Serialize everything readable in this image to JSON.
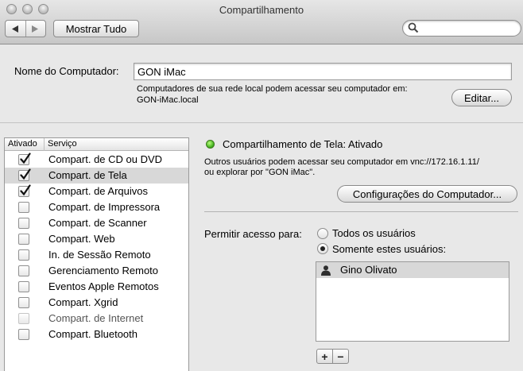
{
  "window": {
    "title": "Compartilhamento"
  },
  "toolbar": {
    "back_icon": "left-triangle",
    "forward_icon": "right-triangle",
    "show_all_label": "Mostrar Tudo",
    "search_placeholder": ""
  },
  "computer": {
    "name_label": "Nome do Computador:",
    "name_value": "GON iMac",
    "info_line1": "Computadores de sua rede local podem acessar seu computador em:",
    "info_line2": "GON-iMac.local",
    "edit_label": "Editar..."
  },
  "services": {
    "header_enabled": "Ativado",
    "header_service": "Serviço",
    "items": [
      {
        "label": "Compart. de CD ou DVD",
        "checked": true
      },
      {
        "label": "Compart. de Tela",
        "checked": true,
        "selected": true
      },
      {
        "label": "Compart. de Arquivos",
        "checked": true
      },
      {
        "label": "Compart. de Impressora",
        "checked": false
      },
      {
        "label": "Compart. de Scanner",
        "checked": false
      },
      {
        "label": "Compart. Web",
        "checked": false
      },
      {
        "label": "In. de Sessão Remoto",
        "checked": false
      },
      {
        "label": "Gerenciamento Remoto",
        "checked": false
      },
      {
        "label": "Eventos Apple Remotos",
        "checked": false
      },
      {
        "label": "Compart. Xgrid",
        "checked": false
      },
      {
        "label": "Compart. de Internet",
        "checked": false,
        "disabled": true
      },
      {
        "label": "Compart. Bluetooth",
        "checked": false
      }
    ]
  },
  "detail": {
    "status_color": "#3aa91a",
    "status_text": "Compartilhamento de Tela: Ativado",
    "info_line1": "Outros usuários podem acessar seu computador em vnc://172.16.1.11/",
    "info_line2": "ou explorar por \"GON iMac\".",
    "computer_settings_label": "Configurações do Computador...",
    "allow_label": "Permitir acesso para:",
    "radio_all_label": "Todos os usuários",
    "radio_only_label": "Somente estes usuários:",
    "selected_option": "only",
    "users": [
      {
        "name": "Gino Olivato",
        "icon": "user-silhouette-icon"
      }
    ],
    "add_label": "+",
    "remove_label": "−"
  }
}
